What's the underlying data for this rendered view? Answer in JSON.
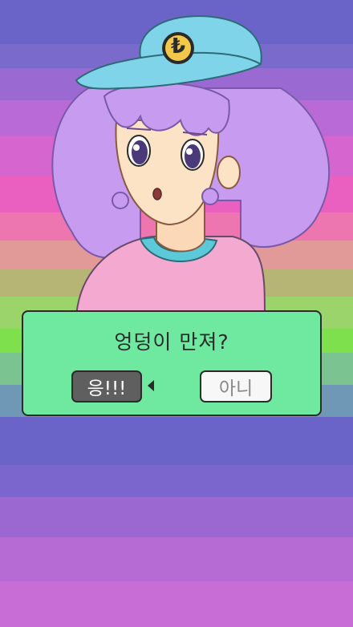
{
  "dialog": {
    "question": "엉덩이 만져?",
    "yes_label": "응!!!",
    "no_label": "아니"
  },
  "cap": {
    "logo": "₺"
  },
  "colors": {
    "stripes": [
      "#6a63c8",
      "#8a6cd0",
      "#c46fd8",
      "#e65fc2",
      "#ee7fb0",
      "#b8b070",
      "#8fd85a",
      "#7fbf8a",
      "#6a8fb8",
      "#6a63c8"
    ],
    "dialog_bg": "#6fe8a0",
    "hair": "#c79cf0",
    "cap": "#7fd4ea",
    "shirt": "#f4a9d0"
  }
}
